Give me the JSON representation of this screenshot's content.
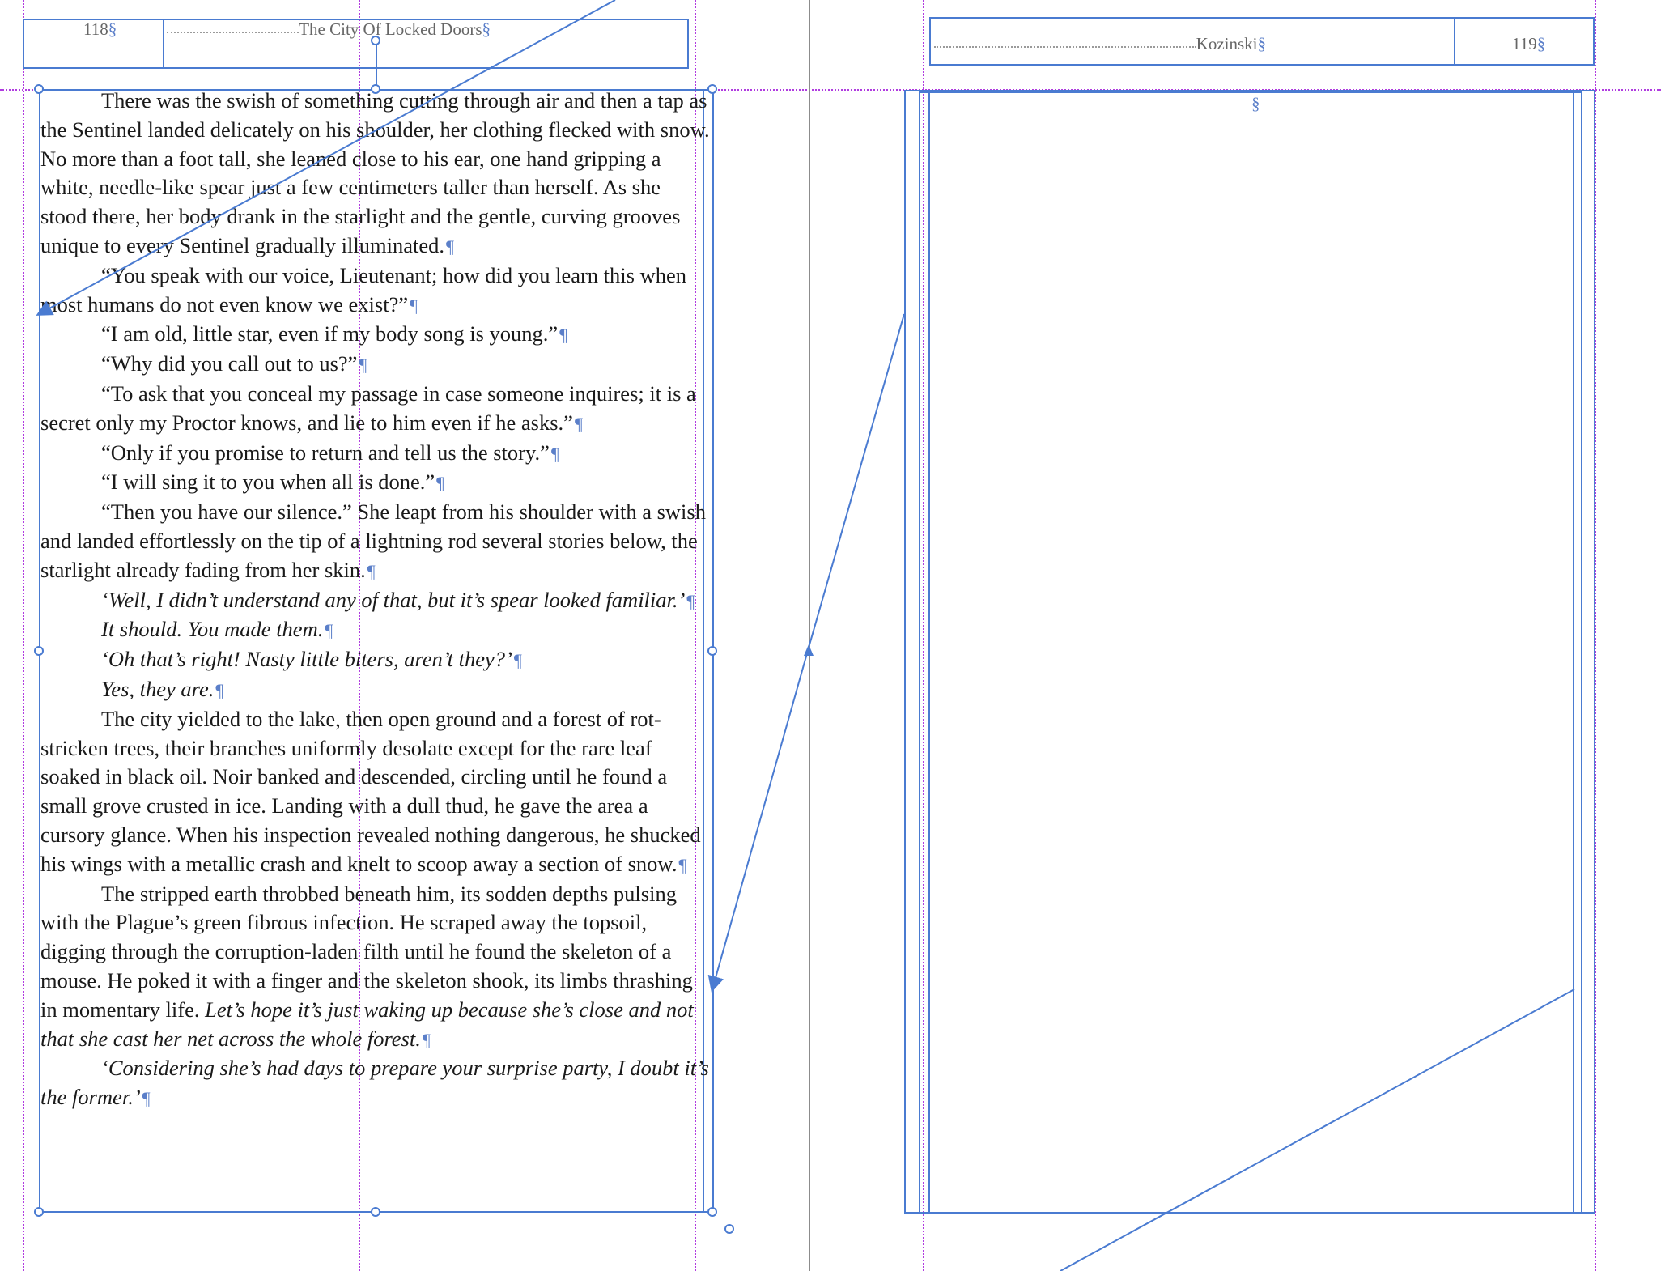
{
  "left_page": {
    "page_number": "118",
    "running_head": "The City Of Locked Doors",
    "section_mark": "§",
    "pilcrow": "¶",
    "paragraphs": [
      {
        "text": "There was the swish of something cutting through air and then a tap as the Sentinel landed delicately on his shoulder, her clothing flecked with snow. No more than a foot tall, she leaned close to his ear, one hand gripping a white, needle-like spear just a few centimeters taller than herself. As she stood there, her body drank in the starlight and the gentle, curving grooves unique to every Sentinel gradually illuminated."
      },
      {
        "text": "“You speak with our voice, Lieutenant; how did you learn this when most humans do not even know we exist?”"
      },
      {
        "text": "“I am old, little star, even if my body song is young.”"
      },
      {
        "text": "“Why did you call out to us?”"
      },
      {
        "text": "“To ask that you conceal my passage in case someone inquires; it is a secret only my Proctor knows, and lie to him even if he asks.”"
      },
      {
        "text": "“Only if you promise to return and tell us the story.”"
      },
      {
        "text": "“I will sing it to you when all is done.”"
      },
      {
        "text": "“Then you have our silence.” She leapt from his shoulder with a swish and landed effortlessly on the tip of a lightning rod several stories below, the starlight already fading from her skin."
      },
      {
        "text": "‘Well, I didn’t understand any of that, but it’s spear looked familiar.’",
        "italic": true
      },
      {
        "text": "It should. You made them.",
        "italic": true
      },
      {
        "text": "‘Oh that’s right! Nasty little biters, aren’t they?’",
        "italic": true
      },
      {
        "text": "Yes, they are.",
        "italic": true
      },
      {
        "text": "The city yielded to the lake, then open ground and a forest of rot-stricken trees, their branches uniformly desolate except for the rare leaf soaked in black oil. Noir banked and descended, circling until he found a small grove crusted in ice. Landing with a dull thud, he gave the area a cursory glance. When his inspection revealed nothing dangerous, he shucked his wings with a metallic crash and knelt to scoop away a section of snow."
      },
      {
        "text": "The stripped earth throbbed beneath him, its sodden depths pulsing with the Plague’s green fibrous infection. He scraped away the topsoil, digging through the corruption-laden filth until he found the skeleton of a mouse. He poked it with a finger and the skeleton shook, its limbs thrashing in momentary life.",
        "italic_tail": "Let’s hope it’s just waking up because she’s close and not that she cast her net across the whole forest."
      },
      {
        "text": "‘Considering she’s had days to prepare your surprise party, I doubt it’s the former.’",
        "italic": true
      }
    ]
  },
  "right_page": {
    "page_number": "119",
    "running_head": "Kozinski",
    "section_mark": "§"
  },
  "colors": {
    "frame": "#4a7bd1",
    "guide": "#b03ce0",
    "spine": "#8c8c8c",
    "pilcrow": "#5b7fc9"
  }
}
